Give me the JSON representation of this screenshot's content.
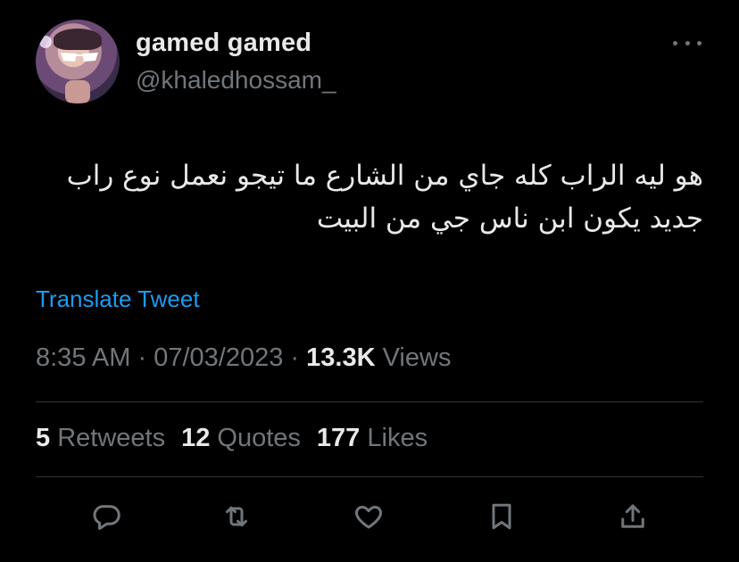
{
  "user": {
    "display_name": "gamed gamed",
    "handle": "@khaledhossam_"
  },
  "icons": {
    "more": "more-horizontal-icon",
    "reply": "reply-icon",
    "retweet": "retweet-icon",
    "like": "heart-icon",
    "bookmark": "bookmark-icon",
    "share": "share-icon"
  },
  "tweet": {
    "line1": "هو ليه الراب كله جاي من الشارع ما تيجو نعمل نوع راب",
    "line2": "جديد يكون ابن ناس جي من البيت",
    "translate_label": "Translate Tweet",
    "time": "8:35 AM",
    "separator": "·",
    "date": "07/03/2023",
    "views_count": "13.3K",
    "views_label": "Views"
  },
  "stats": {
    "retweets_count": "5",
    "retweets_label": "Retweets",
    "quotes_count": "12",
    "quotes_label": "Quotes",
    "likes_count": "177",
    "likes_label": "Likes"
  },
  "colors": {
    "background": "#000000",
    "text": "#e7e9ea",
    "secondary": "#71767b",
    "link": "#1d9bf0",
    "divider": "#2f3336"
  }
}
